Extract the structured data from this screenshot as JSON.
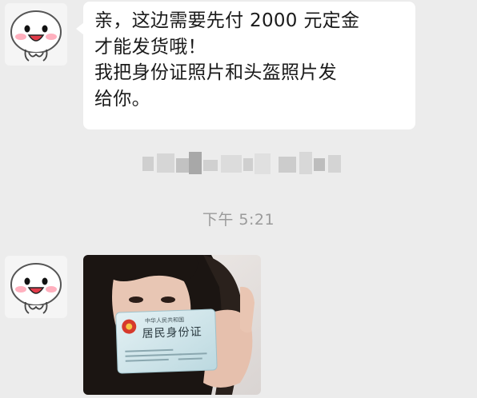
{
  "messages": [
    {
      "type": "text",
      "lines": [
        "亲，这边需要先付 2000 元定金",
        "才能发货哦！",
        "我把身份证照片和头盔照片发",
        "给你。"
      ]
    },
    {
      "type": "image",
      "card": {
        "country": "中华人民共和国",
        "title": "居民身份证"
      }
    }
  ],
  "timestamp": "下午 5:21",
  "icons": {
    "avatar": "cute-blob-avatar",
    "emblem": "national-emblem-icon"
  },
  "colors": {
    "background": "#ececec",
    "bubble": "#ffffff",
    "text": "#1a1a1a",
    "timestamp": "#9a9a9a",
    "card": "#cfe5ea"
  }
}
